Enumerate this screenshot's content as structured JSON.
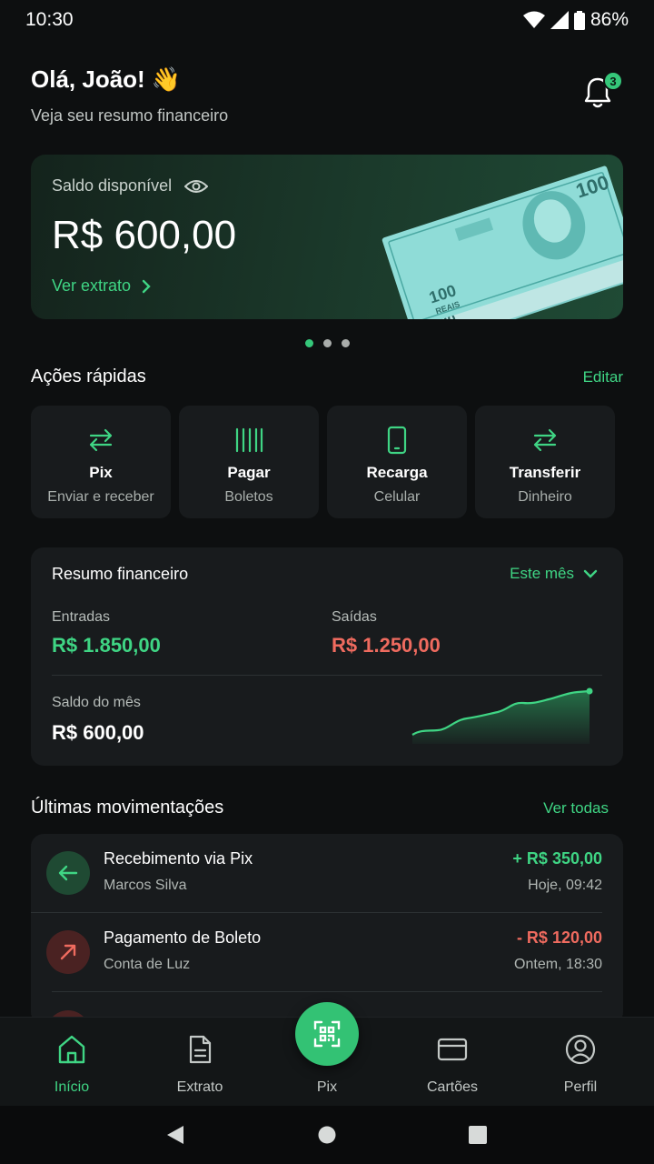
{
  "status": {
    "time": "10:30",
    "battery": "86%"
  },
  "header": {
    "greeting": "Olá, João! 👋",
    "subtitle": "Veja seu resumo financeiro",
    "notifications": "3"
  },
  "balance": {
    "label": "Saldo disponível",
    "value": "R$ 600,00",
    "link": "Ver extrato"
  },
  "carousel": {
    "total": 3,
    "active": 1
  },
  "quick_actions": {
    "title": "Ações rápidas",
    "edit": "Editar",
    "items": [
      {
        "title": "Pix",
        "subtitle": "Enviar e receber",
        "icon": "transfer-arrows-icon"
      },
      {
        "title": "Pagar",
        "subtitle": "Boletos",
        "icon": "barcode-icon"
      },
      {
        "title": "Recarga",
        "subtitle": "Celular",
        "icon": "phone-icon"
      },
      {
        "title": "Transferir",
        "subtitle": "Dinheiro",
        "icon": "transfer-arrows-icon"
      }
    ]
  },
  "summary": {
    "title": "Resumo financeiro",
    "period": "Este mês",
    "income_label": "Entradas",
    "income_value": "R$ 1.850,00",
    "expense_label": "Saídas",
    "expense_value": "R$ 1.250,00",
    "month_label": "Saldo do mês",
    "month_value": "R$ 600,00"
  },
  "transactions": {
    "title": "Últimas movimentações",
    "see_all": "Ver todas",
    "items": [
      {
        "title": "Recebimento via Pix",
        "subtitle": "Marcos Silva",
        "amount": "+ R$ 350,00",
        "time": "Hoje, 09:42",
        "type": "in"
      },
      {
        "title": "Pagamento de Boleto",
        "subtitle": "Conta de Luz",
        "amount": "- R$ 120,00",
        "time": "Ontem, 18:30",
        "type": "out"
      }
    ]
  },
  "nav": {
    "items": [
      {
        "label": "Início",
        "icon": "home-icon"
      },
      {
        "label": "Extrato",
        "icon": "document-icon"
      },
      {
        "label": "Pix",
        "icon": "qr-code-icon"
      },
      {
        "label": "Cartões",
        "icon": "card-icon"
      },
      {
        "label": "Perfil",
        "icon": "user-icon"
      }
    ]
  },
  "colors": {
    "accent": "#3fd584",
    "negative": "#ef6b5f",
    "background": "#0d0f10",
    "surface": "#181b1d"
  }
}
